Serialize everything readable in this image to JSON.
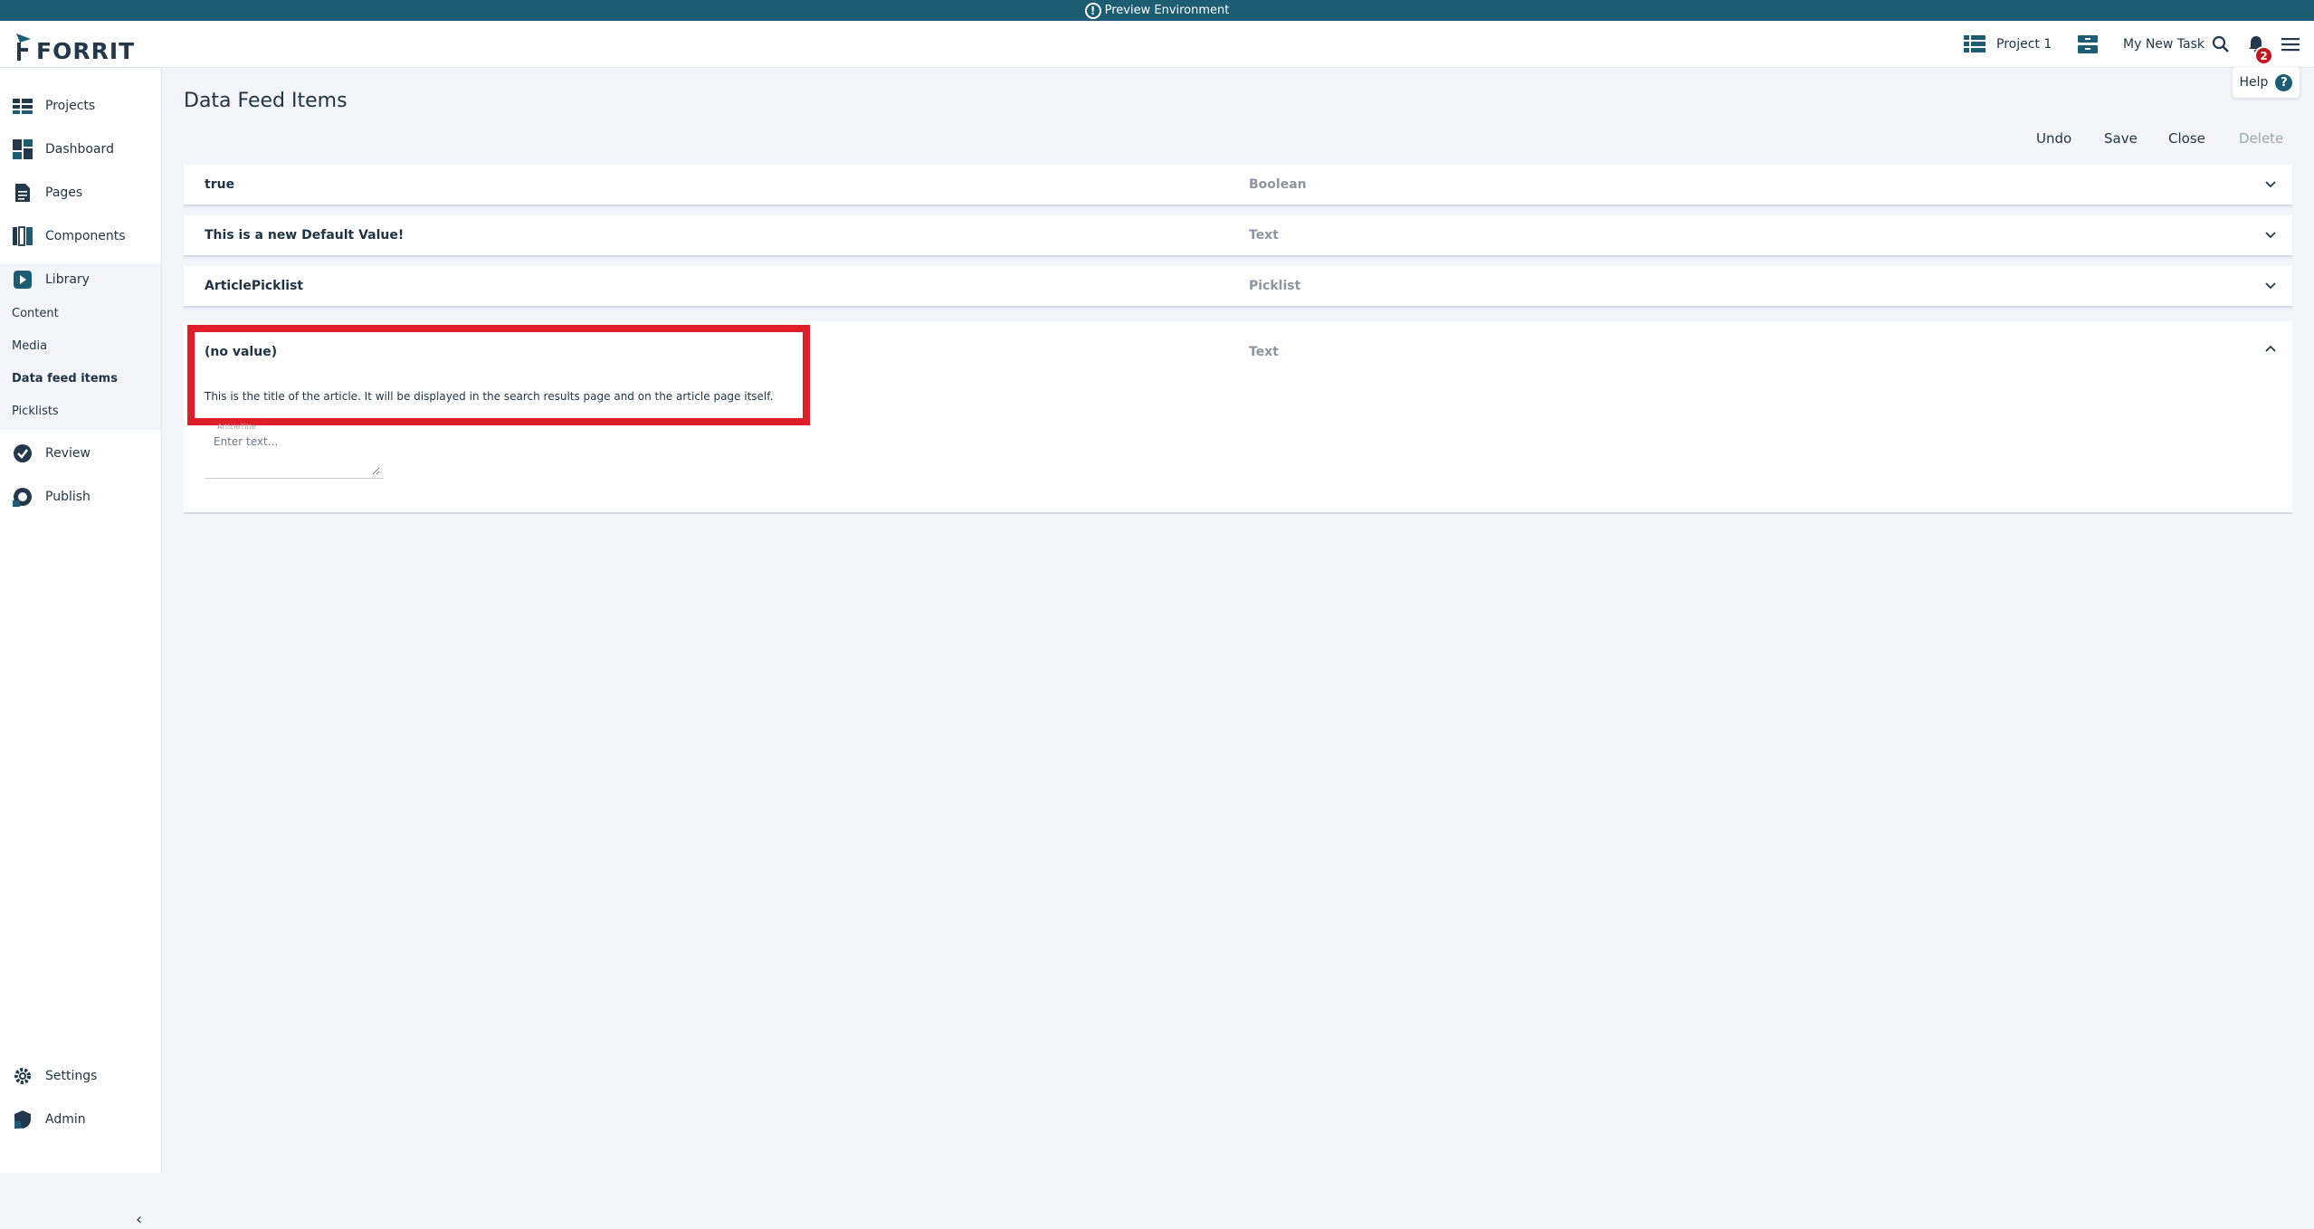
{
  "banner": {
    "text": "Preview Environment",
    "icon": "exclamation-circle-icon"
  },
  "header": {
    "logo_text": "FORRIT",
    "project_label": "Project 1",
    "task_label": "My New Task",
    "notification_count": "2",
    "help_label": "Help"
  },
  "sidebar": {
    "items": [
      {
        "label": "Projects"
      },
      {
        "label": "Dashboard"
      },
      {
        "label": "Pages"
      },
      {
        "label": "Components"
      },
      {
        "label": "Library"
      },
      {
        "label": "Review"
      },
      {
        "label": "Publish"
      },
      {
        "label": "Settings"
      },
      {
        "label": "Admin"
      }
    ],
    "library_sub": [
      {
        "label": "Content"
      },
      {
        "label": "Media"
      },
      {
        "label": "Data feed items",
        "active": true
      },
      {
        "label": "Picklists"
      }
    ],
    "collapse_glyph": "‹"
  },
  "main": {
    "title": "Data Feed Items",
    "toolbar": {
      "undo": "Undo",
      "save": "Save",
      "close": "Close",
      "delete": "Delete"
    },
    "rows": [
      {
        "value": "true",
        "type": "Boolean"
      },
      {
        "value": "This is a new Default Value!",
        "type": "Text"
      },
      {
        "value": "ArticlePicklist",
        "type": "Picklist"
      }
    ],
    "expanded": {
      "value": "(no value)",
      "type": "Text",
      "description": "This is the title of the article. It will be displayed in the search results page and on the article page itself.",
      "field_label": "ArticleTitle",
      "field_placeholder": "Enter text..."
    }
  },
  "colors": {
    "banner": "#1c5d74",
    "highlight": "#e01e2a",
    "badge": "#c7141a",
    "background": "#f3f5fa"
  }
}
